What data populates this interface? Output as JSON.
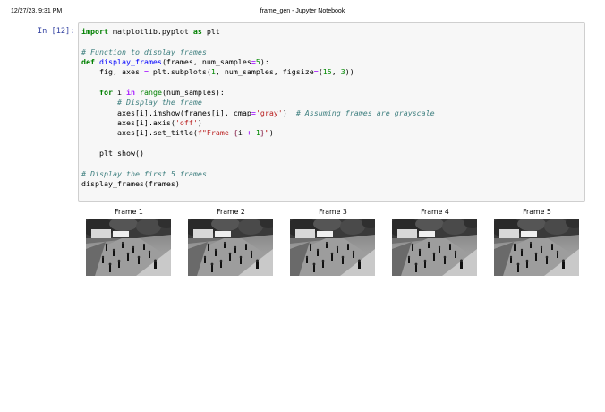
{
  "header": {
    "timestamp": "12/27/23, 9:31 PM",
    "title": "frame_gen - Jupyter Notebook"
  },
  "cell": {
    "prompt": "In [12]:",
    "code": {
      "l1_kw1": "import",
      "l1_mod": " matplotlib.pyplot ",
      "l1_kw2": "as",
      "l1_alias": " plt",
      "l3_comment": "# Function to display frames",
      "l4_kw": "def",
      "l4_fn": " display_frames",
      "l4_a": "(frames, num_samples",
      "l4_eq": "=",
      "l4_n": "5",
      "l4_b": "):",
      "l5_a": "    fig, axes ",
      "l5_eq": "=",
      "l5_b": " plt",
      "l5_c": ".subplots(",
      "l5_n1": "1",
      "l5_d": ", num_samples, figsize",
      "l5_eq2": "=",
      "l5_e": "(",
      "l5_n2": "15",
      "l5_f": ", ",
      "l5_n3": "3",
      "l5_g": "))",
      "l7_a": "    ",
      "l7_kw": "for",
      "l7_b": " i ",
      "l7_in": "in",
      "l7_c": " ",
      "l7_bi": "range",
      "l7_d": "(num_samples):",
      "l8_a": "        ",
      "l8_comment": "# Display the frame",
      "l9_a": "        axes[i]",
      "l9_b": ".imshow(frames[i], cmap",
      "l9_eq": "=",
      "l9_s": "'gray'",
      "l9_c": ")  ",
      "l9_comment": "# Assuming frames are grayscale",
      "l10_a": "        axes[i]",
      "l10_b": ".axis(",
      "l10_s": "'off'",
      "l10_c": ")",
      "l11_a": "        axes[i]",
      "l11_b": ".set_title(",
      "l11_s1": "f\"Frame ",
      "l11_si1": "{",
      "l11_m": "i ",
      "l11_p": "+",
      "l11_sp": " ",
      "l11_n": "1",
      "l11_si2": "}",
      "l11_s2": "\"",
      "l11_c": ")",
      "l13_a": "    plt",
      "l13_b": ".show()",
      "l15_comment": "# Display the first 5 frames",
      "l16": "display_frames(frames)"
    }
  },
  "output": {
    "frames": [
      {
        "title": "Frame 1"
      },
      {
        "title": "Frame 2"
      },
      {
        "title": "Frame 3"
      },
      {
        "title": "Frame 4"
      },
      {
        "title": "Frame 5"
      }
    ]
  }
}
